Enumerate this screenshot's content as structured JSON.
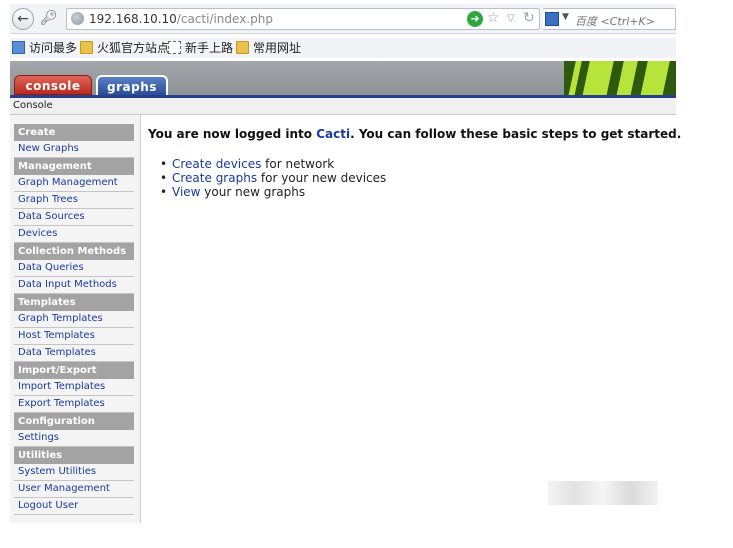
{
  "browser": {
    "url_host": "192.168.10.10",
    "url_path": "/cacti/index.php",
    "search_placeholder": "百度 <Ctrl+K>"
  },
  "bookmarks": [
    {
      "label": "访问最多",
      "icon": "most-visited-icon"
    },
    {
      "label": "火狐官方站点",
      "icon": "folder-icon"
    },
    {
      "label": "新手上路",
      "icon": "page-icon"
    },
    {
      "label": "常用网址",
      "icon": "folder-icon"
    }
  ],
  "tabs": {
    "console": "console",
    "graphs": "graphs"
  },
  "breadcrumb": "Console",
  "menu": [
    {
      "type": "head",
      "label": "Create"
    },
    {
      "type": "item",
      "label": "New Graphs"
    },
    {
      "type": "head",
      "label": "Management"
    },
    {
      "type": "item",
      "label": "Graph Management"
    },
    {
      "type": "item",
      "label": "Graph Trees"
    },
    {
      "type": "item",
      "label": "Data Sources"
    },
    {
      "type": "item",
      "label": "Devices"
    },
    {
      "type": "head",
      "label": "Collection Methods"
    },
    {
      "type": "item",
      "label": "Data Queries"
    },
    {
      "type": "item",
      "label": "Data Input Methods"
    },
    {
      "type": "head",
      "label": "Templates"
    },
    {
      "type": "item",
      "label": "Graph Templates"
    },
    {
      "type": "item",
      "label": "Host Templates"
    },
    {
      "type": "item",
      "label": "Data Templates"
    },
    {
      "type": "head",
      "label": "Import/Export"
    },
    {
      "type": "item",
      "label": "Import Templates"
    },
    {
      "type": "item",
      "label": "Export Templates"
    },
    {
      "type": "head",
      "label": "Configuration"
    },
    {
      "type": "item",
      "label": "Settings"
    },
    {
      "type": "head",
      "label": "Utilities"
    },
    {
      "type": "item",
      "label": "System Utilities"
    },
    {
      "type": "item",
      "label": "User Management"
    },
    {
      "type": "item",
      "label": "Logout User"
    }
  ],
  "main": {
    "welcome_prefix": "You are now logged into ",
    "welcome_link": "Cacti",
    "welcome_suffix": ". You can follow these basic steps to get started.",
    "steps": [
      {
        "link": "Create devices",
        "text": " for network"
      },
      {
        "link": "Create graphs",
        "text": " for your new devices"
      },
      {
        "link": "View",
        "text": " your new graphs"
      }
    ]
  },
  "colors": {
    "link": "#1a3aa0",
    "menu_header": "#a3a3a3",
    "console_tab": "#c8372b",
    "graphs_tab": "#2f55a0",
    "header_blue_line": "#27408b"
  }
}
